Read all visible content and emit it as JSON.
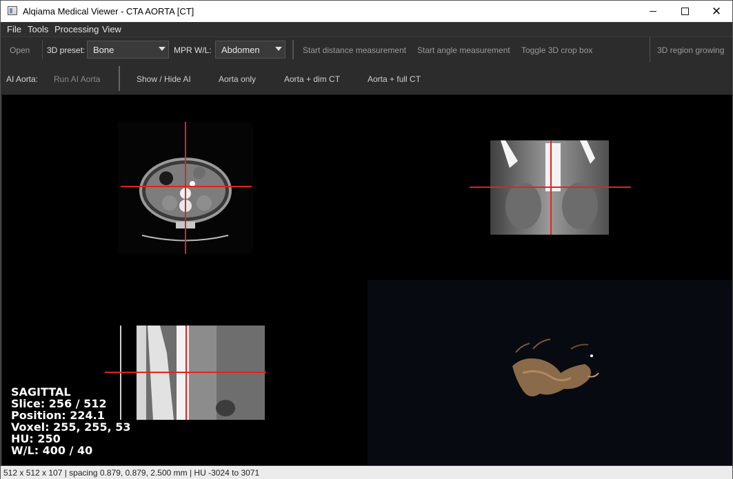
{
  "window": {
    "title": "Alqiama Medical Viewer - CTA AORTA [CT]"
  },
  "titlebar_icons": {
    "minimize": "minimize-icon",
    "maximize": "maximize-icon",
    "close": "close-icon"
  },
  "menu": {
    "items": [
      "File",
      "Tools",
      "Processing",
      "View"
    ]
  },
  "toolbar1": {
    "open": "Open",
    "preset_label": "3D preset:",
    "preset_value": "Bone",
    "mpr_label": "MPR W/L:",
    "mpr_value": "Abdomen",
    "distance": "Start distance measurement",
    "angle": "Start angle measurement",
    "crop": "Toggle 3D crop box",
    "region": "3D region growing"
  },
  "toolbar2": {
    "ai_label": "AI Aorta:",
    "run": "Run AI Aorta",
    "show_hide": "Show / Hide AI",
    "aorta_only": "Aorta only",
    "aorta_dim": "Aorta + dim CT",
    "aorta_full": "Aorta + full CT"
  },
  "overlay": {
    "view": "SAGITTAL",
    "slice": "Slice: 256 / 512",
    "position": "Position: 224.1",
    "voxel": "Voxel: 255, 255, 53",
    "hu": "HU: 250",
    "wl": "W/L: 400 / 40"
  },
  "status": {
    "text": "512 x 512 x 107 | spacing 0.879, 0.879, 2.500 mm | HU -3024 to 3071"
  },
  "colors": {
    "crosshair": "#e0241c",
    "background": "#000000"
  }
}
